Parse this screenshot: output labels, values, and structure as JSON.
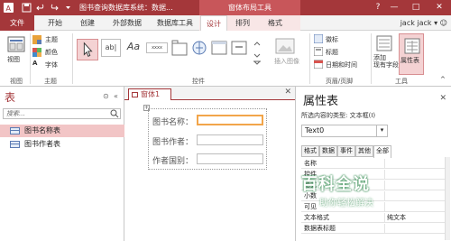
{
  "titlebar": {
    "title": "图书查询数据库系统：数据...",
    "context_title": "窗体布局工具",
    "help": "?",
    "minimize": "—",
    "maximize": "□",
    "close": "✕"
  },
  "tabs": {
    "file": "文件",
    "items": [
      "开始",
      "创建",
      "外部数据",
      "数据库工具",
      "设计",
      "排列",
      "格式"
    ],
    "active": "设计",
    "user": "jack jack"
  },
  "ribbon": {
    "view": {
      "label": "视图",
      "group": "视图"
    },
    "theme": {
      "items": [
        "主题",
        "颜色",
        "字体"
      ],
      "group": "主题"
    },
    "controls": {
      "items": [
        "ab|",
        "Aa",
        "xxxx"
      ],
      "insert_image": "插入图像",
      "group": "控件"
    },
    "header_footer": {
      "items": [
        "徽标",
        "标题",
        "日期和时间"
      ],
      "group": "页眉/页脚"
    },
    "tools": {
      "add_fields": "添加\n现有字段",
      "property_sheet": "属性表",
      "group": "工具"
    }
  },
  "nav": {
    "title": "表",
    "search_placeholder": "搜索...",
    "items": [
      "图书名称表",
      "图书作者表"
    ],
    "selected_index": 0
  },
  "document": {
    "tab_label": "窗体1",
    "fields": [
      {
        "label": "图书名称："
      },
      {
        "label": "图书作者："
      },
      {
        "label": "作者国别："
      }
    ]
  },
  "properties": {
    "title": "属性表",
    "selection_type": "所选内容的类型: 文本框(I)",
    "selected_control": "Text0",
    "tabs": [
      "格式",
      "数据",
      "事件",
      "其他",
      "全部"
    ],
    "active_tab": "全部",
    "rows": [
      {
        "name": "名称",
        "value": ""
      },
      {
        "name": "控件",
        "value": ""
      },
      {
        "name": "格式",
        "value": ""
      },
      {
        "name": "小数",
        "value": ""
      },
      {
        "name": "可见",
        "value": ""
      },
      {
        "name": "文本格式",
        "value": "纯文本"
      },
      {
        "name": "数据表标题",
        "value": ""
      }
    ]
  },
  "watermark": {
    "main": "百科全说",
    "sub": "助你轻松解决"
  },
  "colors": {
    "accent": "#a4373a",
    "selection": "#f2c5c6",
    "focus": "#f2a54a"
  }
}
